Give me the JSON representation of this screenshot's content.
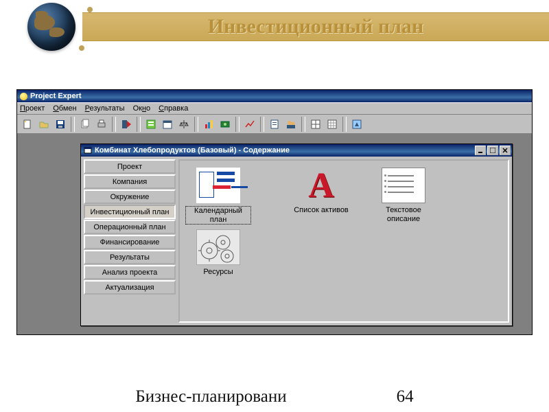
{
  "slide": {
    "title": "Инвестиционный план",
    "footer_label": "Бизнес-планировани",
    "page_number": "64"
  },
  "app": {
    "title": "Project Expert",
    "menus": [
      "Проект",
      "Обмен",
      "Результаты",
      "Окно",
      "Справка"
    ]
  },
  "child_window": {
    "title": "Комбинат Хлебопродуктов (Базовый) - Содержание",
    "sidebar": [
      "Проект",
      "Компания",
      "Окружение",
      "Инвестиционный план",
      "Операционный план",
      "Финансирование",
      "Результаты",
      "Анализ проекта",
      "Актуализация"
    ],
    "active_index": 3,
    "items": [
      {
        "key": "calendar",
        "label": "Календарный план",
        "selected": true
      },
      {
        "key": "gears",
        "label": "Ресурсы"
      },
      {
        "key": "assets",
        "label": "Список активов"
      },
      {
        "key": "text",
        "label": "Текстовое описание"
      }
    ]
  }
}
